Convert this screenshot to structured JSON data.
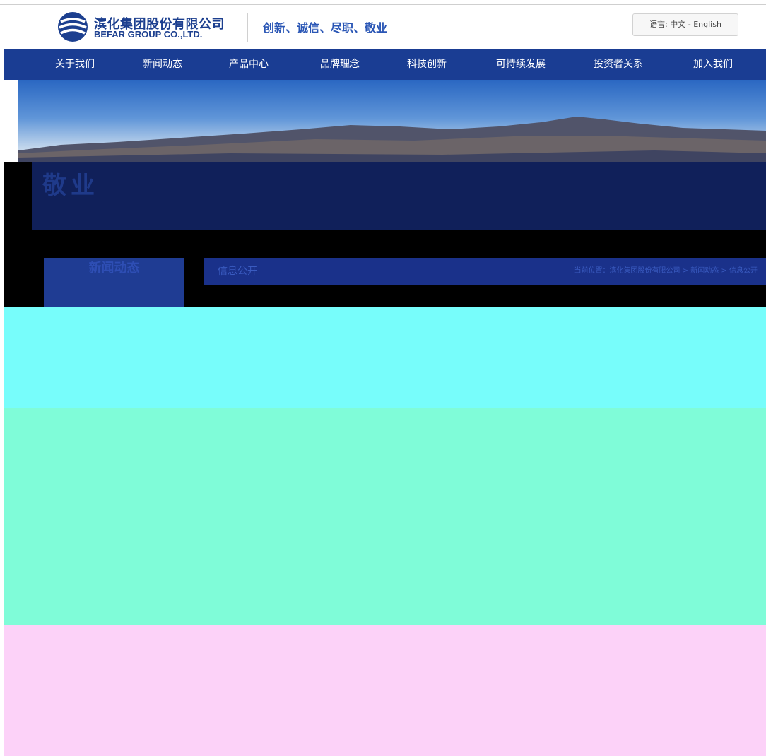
{
  "header": {
    "company_cn": "滨化集团股份有限公司",
    "company_en": "BEFAR GROUP CO.,LTD.",
    "slogan": "创新、诚信、尽职、敬业",
    "language": "语言: 中文 - English"
  },
  "nav": {
    "items": [
      "关于我们",
      "新闻动态",
      "产品中心",
      "品牌理念",
      "科技创新",
      "可持续发展",
      "投资者关系",
      "加入我们"
    ]
  },
  "page": {
    "big_title": "敬业",
    "side_title": "新闻动态",
    "sub_title": "信息公开",
    "breadcrumb": "当前位置：滨化集团股份有限公司 > 新闻动态 > 信息公开"
  },
  "colors": {
    "nav_bg": "#1a3d93",
    "brand": "#1c3f8f",
    "slogan": "#2a56b5"
  }
}
